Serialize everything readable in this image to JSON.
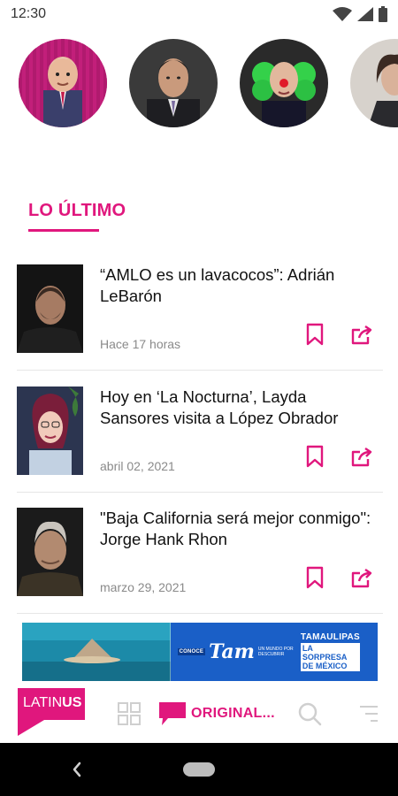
{
  "status_bar": {
    "time": "12:30"
  },
  "section": {
    "title": "LO ÚLTIMO"
  },
  "news": [
    {
      "headline": "“AMLO es un lavacocos”: Adrián LeBarón",
      "date": "Hace 17 horas"
    },
    {
      "headline": "Hoy en ‘La Nocturna’, Layda Sansores visita a López Obrador",
      "date": "abril 02, 2021"
    },
    {
      "headline": "\"Baja California será mejor conmigo\": Jorge Hank Rhon",
      "date": "marzo 29, 2021"
    }
  ],
  "banner": {
    "conoce": "CONOCE",
    "brand": "Tam",
    "tagline": "UN MUNDO POR DESCUBRIR",
    "state": "TAMAULIPAS",
    "slogan_line1": "LA SORPRESA",
    "slogan_line2": "DE MÉXICO"
  },
  "bottom_nav": {
    "logo_part1": "LATIN",
    "logo_part2": "US",
    "originals_label": "ORIGINAL..."
  },
  "colors": {
    "accent": "#e0177d",
    "text": "#111111",
    "muted": "#8a8a8a",
    "banner_blue": "#1a5fc7"
  }
}
